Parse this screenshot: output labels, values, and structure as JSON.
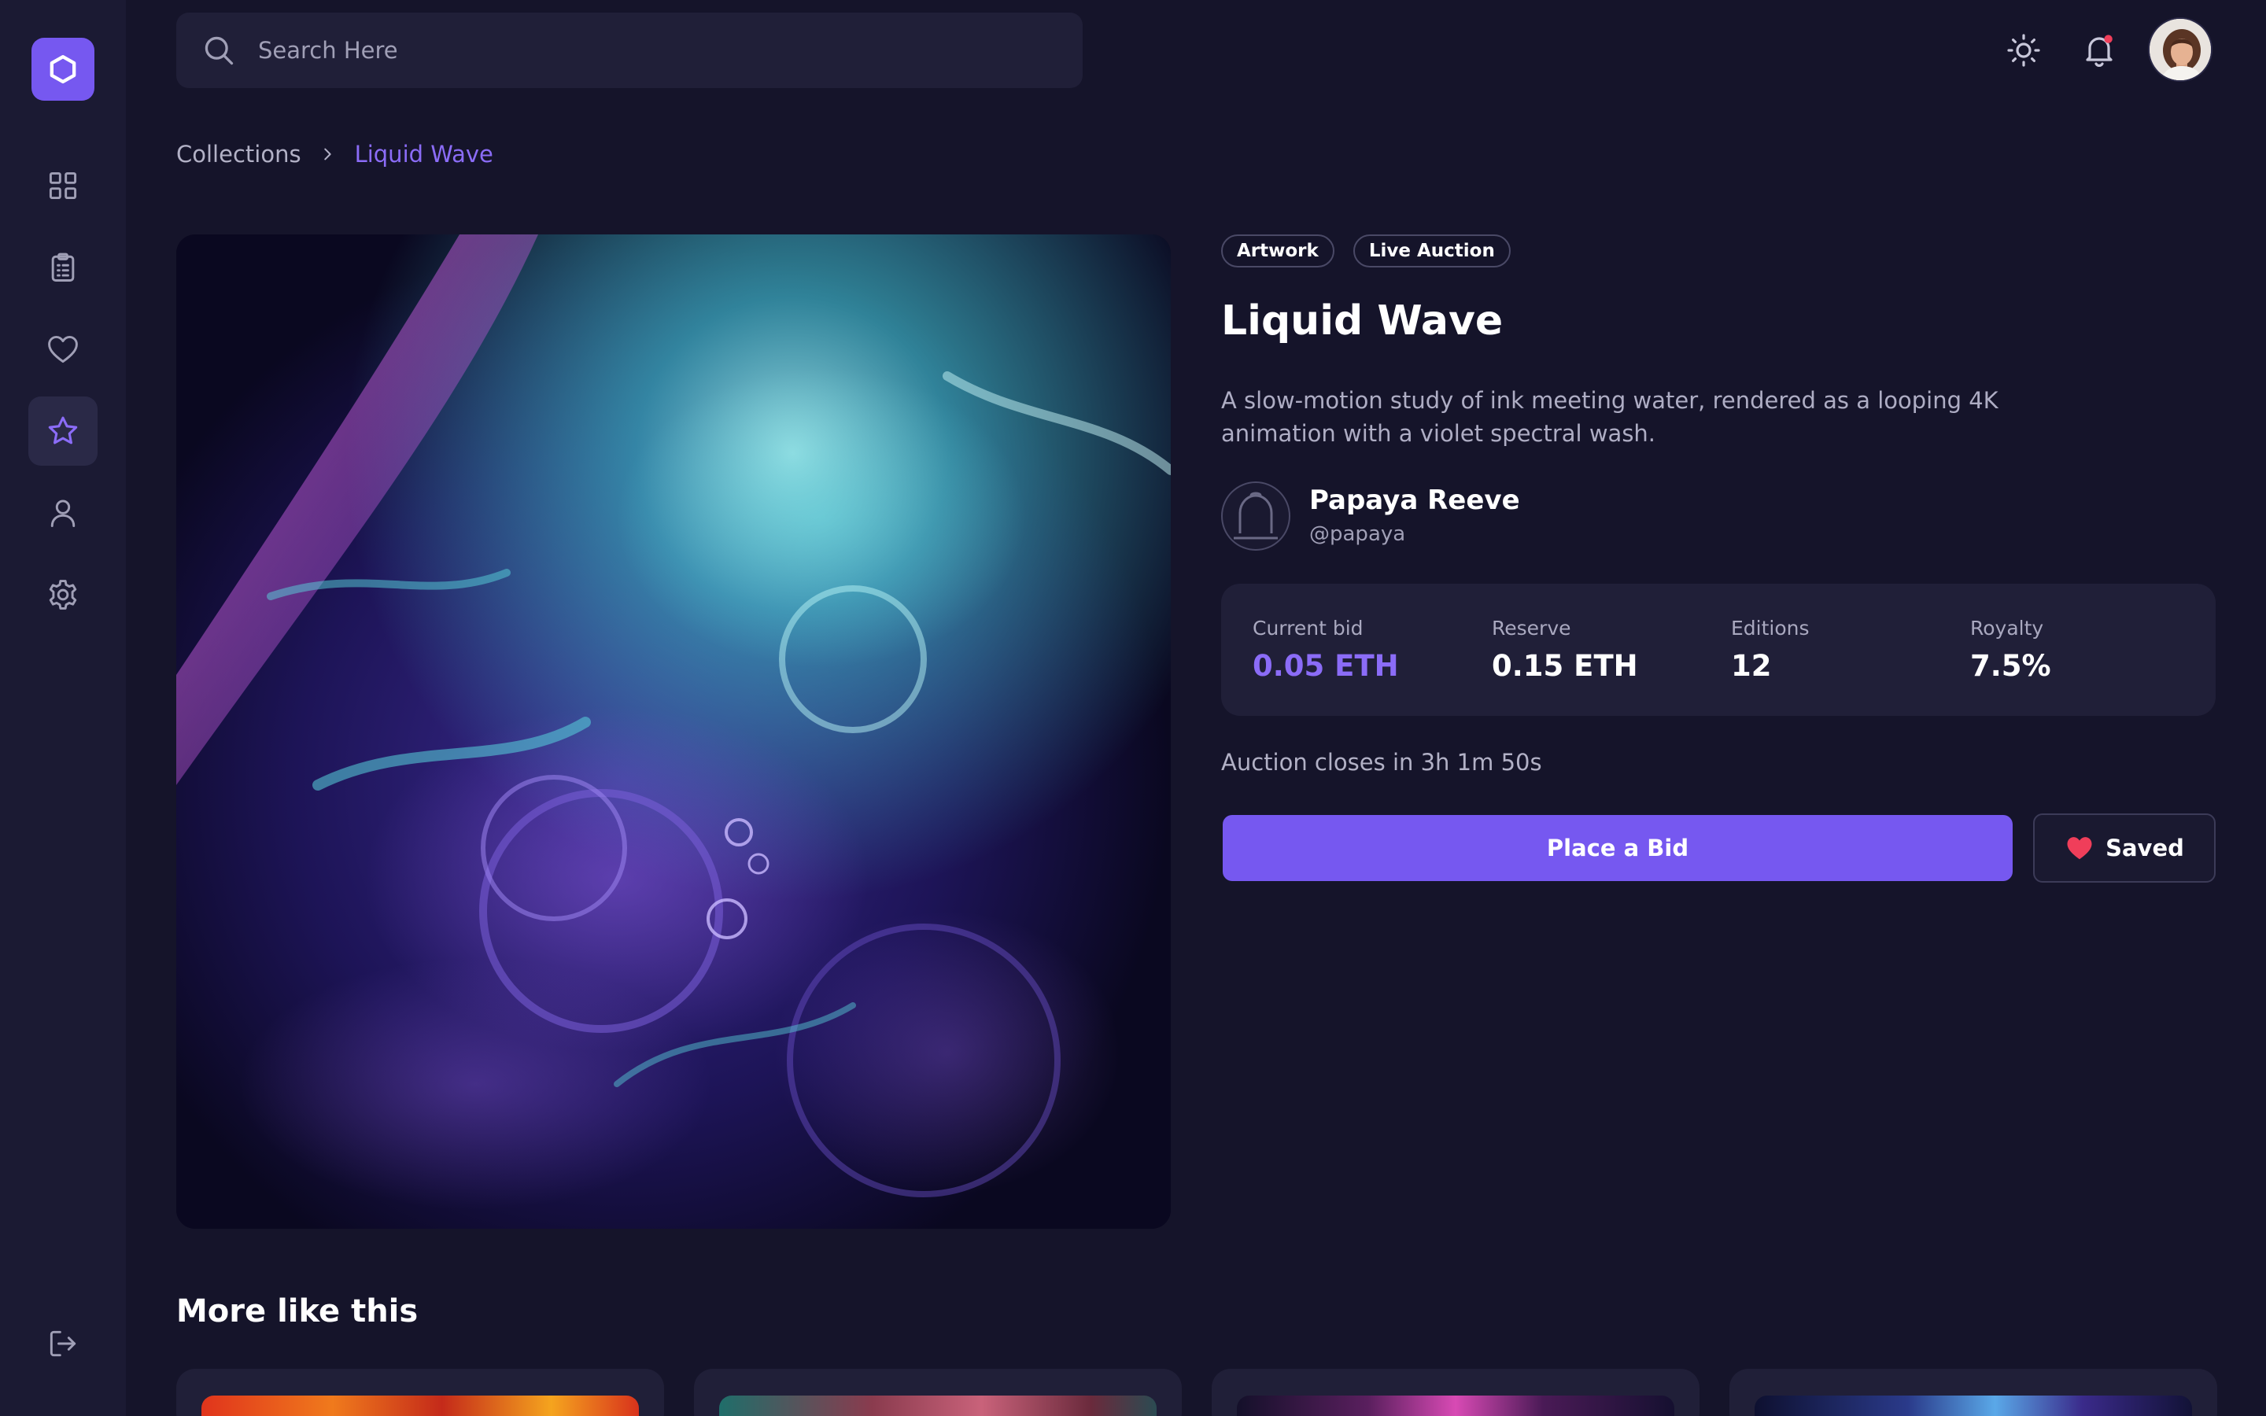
{
  "search": {
    "placeholder": "Search Here"
  },
  "sidebar": {
    "logo": "hexagon-logo",
    "items": [
      {
        "icon": "grid-icon",
        "active": false
      },
      {
        "icon": "clipboard-icon",
        "active": false
      },
      {
        "icon": "heart-icon",
        "active": false
      },
      {
        "icon": "star-icon",
        "active": true
      },
      {
        "icon": "user-icon",
        "active": false
      },
      {
        "icon": "gear-icon",
        "active": false
      }
    ],
    "footer_icon": "logout-icon"
  },
  "header": {
    "icons": [
      "sun-icon",
      "bell-icon",
      "avatar"
    ]
  },
  "breadcrumb": {
    "parent": "Collections",
    "current": "Liquid Wave"
  },
  "artwork": {
    "tags": [
      "Artwork",
      "Live Auction"
    ],
    "title": "Liquid Wave",
    "description": "A slow-motion study of ink meeting water, rendered as a looping 4K animation with a violet spectral wash.",
    "creator": {
      "name": "Papaya Reeve",
      "handle": "@papaya"
    }
  },
  "stats": [
    {
      "label": "Current bid",
      "value": "0.05 ETH"
    },
    {
      "label": "Reserve",
      "value": "0.15 ETH"
    },
    {
      "label": "Editions",
      "value": "12"
    },
    {
      "label": "Royalty",
      "value": "7.5%"
    }
  ],
  "auction": {
    "timer": "Auction closes in 3h 1m 50s"
  },
  "actions": {
    "bid_label": "Place a Bid",
    "saved_label": "Saved"
  },
  "more": {
    "title": "More like this"
  },
  "colors": {
    "accent": "#7658f0",
    "accent_text": "#8b6cf7",
    "saved_heart": "#f03e5a",
    "background": "#15142a"
  }
}
